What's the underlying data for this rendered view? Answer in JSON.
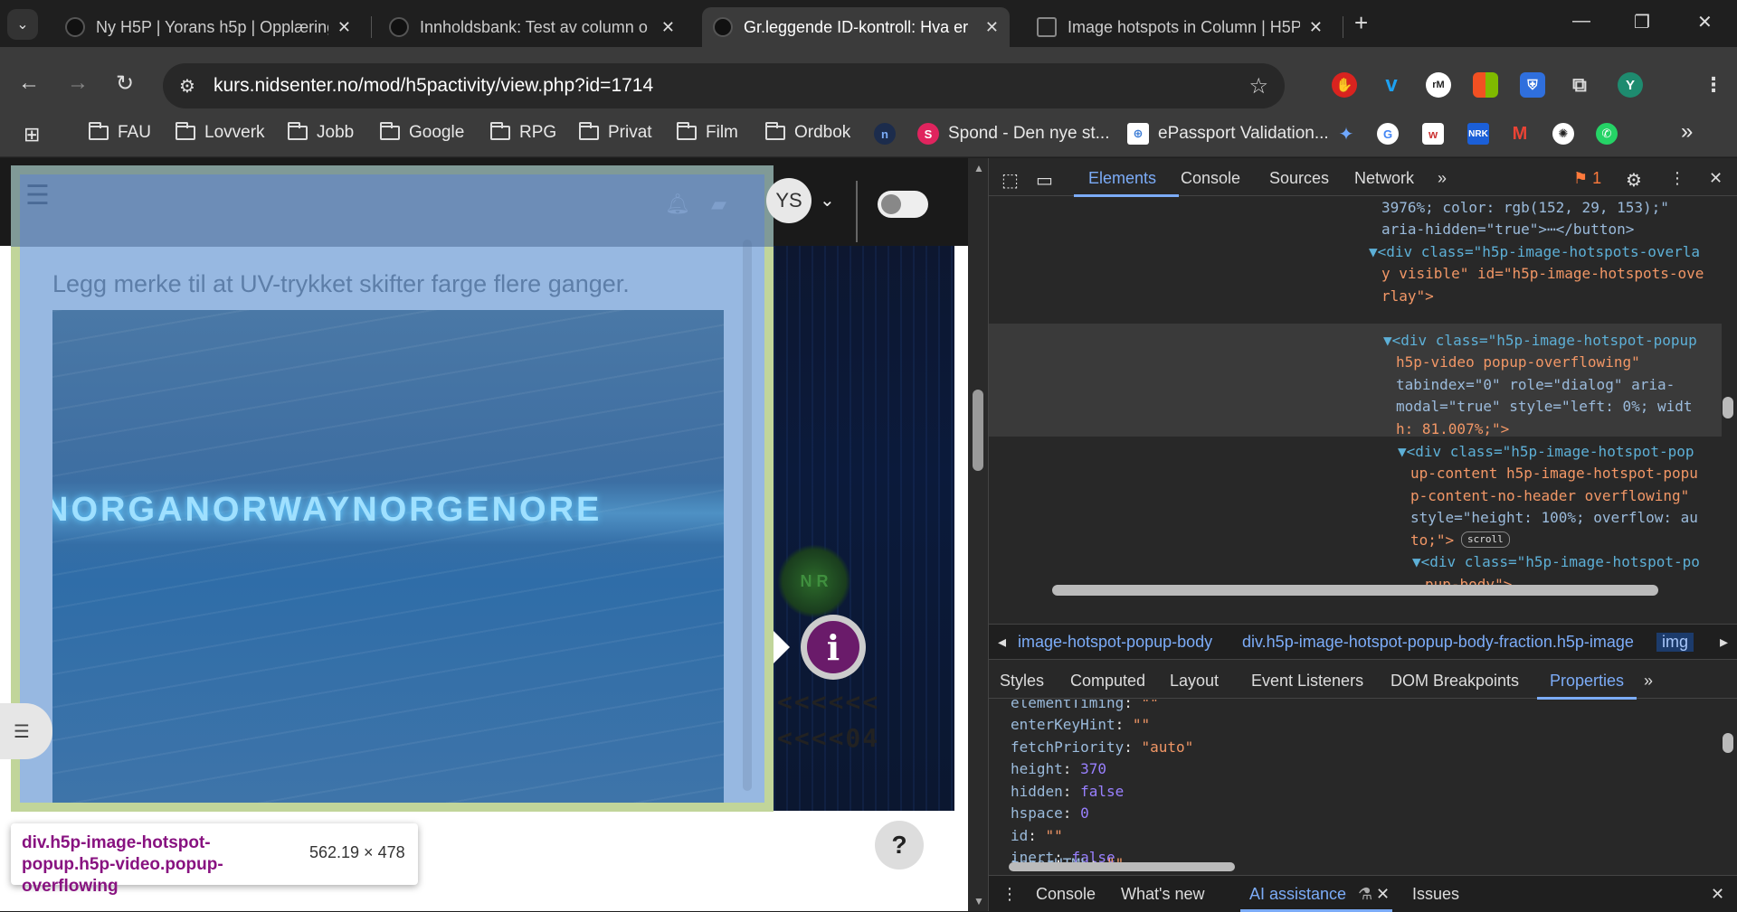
{
  "browser": {
    "tabs": [
      {
        "title": "Ny H5P | Yorans h5p | Opplæring"
      },
      {
        "title": "Innholdsbank: Test av column o"
      },
      {
        "title": "Gr.leggende ID-kontroll: Hva er"
      },
      {
        "title": "Image hotspots in Column | H5P"
      }
    ],
    "new_tab": "+",
    "url": "kurs.nidsenter.no/mod/h5pactivity/view.php?id=1714",
    "profile_initial": "Y",
    "bookmarks": [
      {
        "label": "FAU",
        "icon": "folder-icon"
      },
      {
        "label": "Lovverk",
        "icon": "folder-icon"
      },
      {
        "label": "Jobb",
        "icon": "folder-icon"
      },
      {
        "label": "Google",
        "icon": "folder-icon"
      },
      {
        "label": "RPG",
        "icon": "folder-icon"
      },
      {
        "label": "Privat",
        "icon": "folder-icon"
      },
      {
        "label": "Film",
        "icon": "folder-icon"
      },
      {
        "label": "Ordbok",
        "icon": "folder-icon"
      },
      {
        "label": "Spond - Den nye st...",
        "icon": "spond-icon"
      },
      {
        "label": "ePassport Validation...",
        "icon": "un-icon"
      }
    ],
    "bookmarks_more": "»"
  },
  "page": {
    "popup_text": "Legg merke til at UV-trykket skifter farge flere ganger.",
    "uv_print": "NORGANORWAYNORGENORE",
    "avatar_initials": "YS",
    "bg_seal": "N R",
    "bg_mrz_1": "<<<<<<",
    "bg_mrz_2": "<<<<04",
    "help_label": "?",
    "info_label": "i"
  },
  "inspect_tooltip": {
    "selector": "div.h5p-image-hotspot-popup.h5p-video.popup-overflowing",
    "size": "562.19 × 478"
  },
  "devtools": {
    "tabs": [
      "Elements",
      "Console",
      "Sources",
      "Network"
    ],
    "active_tab": "Elements",
    "issues_count": "1",
    "dom_lines": [
      {
        "text": "3976%; color: rgb(152, 29, 153);\""
      },
      {
        "text": "aria-hidden=\"true\">⋯</button>"
      },
      {
        "text": "▼<div class=\"h5p-image-hotspots-overla"
      },
      {
        "text": "y visible\" id=\"h5p-image-hotspots-ove"
      },
      {
        "text": "rlay\">"
      },
      {
        "text": "▼<div class=\"h5p-image-hotspot-popup"
      },
      {
        "text": "h5p-video popup-overflowing\""
      },
      {
        "text": "tabindex=\"0\" role=\"dialog\" aria-"
      },
      {
        "text": "modal=\"true\" style=\"left: 0%; widt"
      },
      {
        "text": "h: 81.007%;\">"
      },
      {
        "text": "▼<div class=\"h5p-image-hotspot-pop"
      },
      {
        "text": "up-content h5p-image-hotspot-popu"
      },
      {
        "text": "p-content-no-header overflowing\""
      },
      {
        "text": "style=\"height: 100%; overflow: au"
      },
      {
        "text": "to;\">"
      },
      {
        "text": "▼<div class=\"h5p-image-hotspot-po"
      },
      {
        "text": "pup-body\">"
      }
    ],
    "scroll_badge": "scroll",
    "breadcrumbs": [
      "image-hotspot-popup-body",
      "div.h5p-image-hotspot-popup-body-fraction.h5p-image",
      "img"
    ],
    "panel_tabs": [
      "Styles",
      "Computed",
      "Layout",
      "Event Listeners",
      "DOM Breakpoints",
      "Properties"
    ],
    "active_panel": "Properties",
    "properties": [
      {
        "key": "elementTiming",
        "value": "\"\"",
        "kind": "str"
      },
      {
        "key": "enterKeyHint",
        "value": "\"\"",
        "kind": "str"
      },
      {
        "key": "fetchPriority",
        "value": "\"auto\"",
        "kind": "str"
      },
      {
        "key": "height",
        "value": "370",
        "kind": "num"
      },
      {
        "key": "hidden",
        "value": "false",
        "kind": "bool"
      },
      {
        "key": "hspace",
        "value": "0",
        "kind": "num"
      },
      {
        "key": "id",
        "value": "\"\"",
        "kind": "str"
      },
      {
        "key": "inert",
        "value": "false",
        "kind": "bool"
      },
      {
        "key": "innerHTML",
        "value": "\"\"",
        "kind": "str"
      }
    ],
    "drawer_tabs": [
      "Console",
      "What's new",
      "AI assistance",
      "Issues"
    ]
  }
}
